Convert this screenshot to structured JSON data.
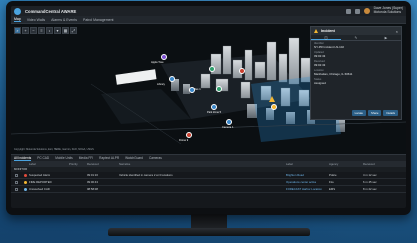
{
  "app": {
    "title": "CommandCentral AWARE",
    "user_name": "Dave Jones (Super)",
    "user_org": "Motorola Solutions"
  },
  "tabs": [
    "Map",
    "Video Walls",
    "Alarms & Events",
    "Patrol Management"
  ],
  "map": {
    "tools": [
      "search-icon",
      "zoom-in-icon",
      "zoom-out-icon",
      "layers-icon",
      "pin-icon",
      "filter-icon",
      "grid-icon",
      "expand-icon"
    ],
    "labels": [
      "Apple Tree",
      "Library",
      "Bus 1",
      "Park Zone 5",
      "Camera 1",
      "Drone 9",
      "Harbor"
    ],
    "legend": "Copyright: Motorola Solutions, Esri, HERE, Garmin, FAO, NOAA, USGS"
  },
  "panel": {
    "title": "Incident",
    "tabs": [
      "info-icon",
      "edit-icon",
      "video-icon"
    ],
    "fields": [
      {
        "k": "Identifier",
        "v": "NY-PR Incident LN-102"
      },
      {
        "k": "Updated",
        "v": "09:02:43"
      },
      {
        "k": "Received",
        "v": "09:02:43"
      },
      {
        "k": "Location",
        "v": "Manhattan, Chicago, IL 60611"
      },
      {
        "k": "Status",
        "v": "Assigned"
      }
    ],
    "actions": [
      "Locate",
      "Share",
      "Details"
    ]
  },
  "grid": {
    "tabs": [
      "All Incidents",
      "PC CAD",
      "Mobile Units",
      "Media FFI",
      "Raptect ALPR",
      "WatchGuard",
      "Cameras"
    ],
    "headers": [
      "Label",
      "Priority",
      "Received",
      "Narrative",
      "Label",
      "Agency",
      "Received"
    ],
    "group": "MONITOR",
    "rows": [
      {
        "label": "Suspected Alarm",
        "received": "09:01:16",
        "narrative": "Vehicle identified in camera 2 at 3 locations",
        "label2": "Brighton Road",
        "agency": "Police",
        "time": "4 m 12 sec",
        "color": "#e04b3c"
      },
      {
        "label": "FIRE REPORTED",
        "received": "09:00:43",
        "narrative": "",
        "label2": "Operations center active",
        "agency": "Fire",
        "time": "6 m 45 sec",
        "color": "#f2b632"
      },
      {
        "label": "Unresolved CAD",
        "received": "08:58:08",
        "narrative": "",
        "label2": "FORECAST Harbor Location",
        "agency": "EMS",
        "time": "8 m 22 sec",
        "color": "#6fb6ea"
      }
    ]
  },
  "colors": {
    "accent": "#4aa3df",
    "warning": "#f2b632",
    "danger": "#e04b3c"
  }
}
